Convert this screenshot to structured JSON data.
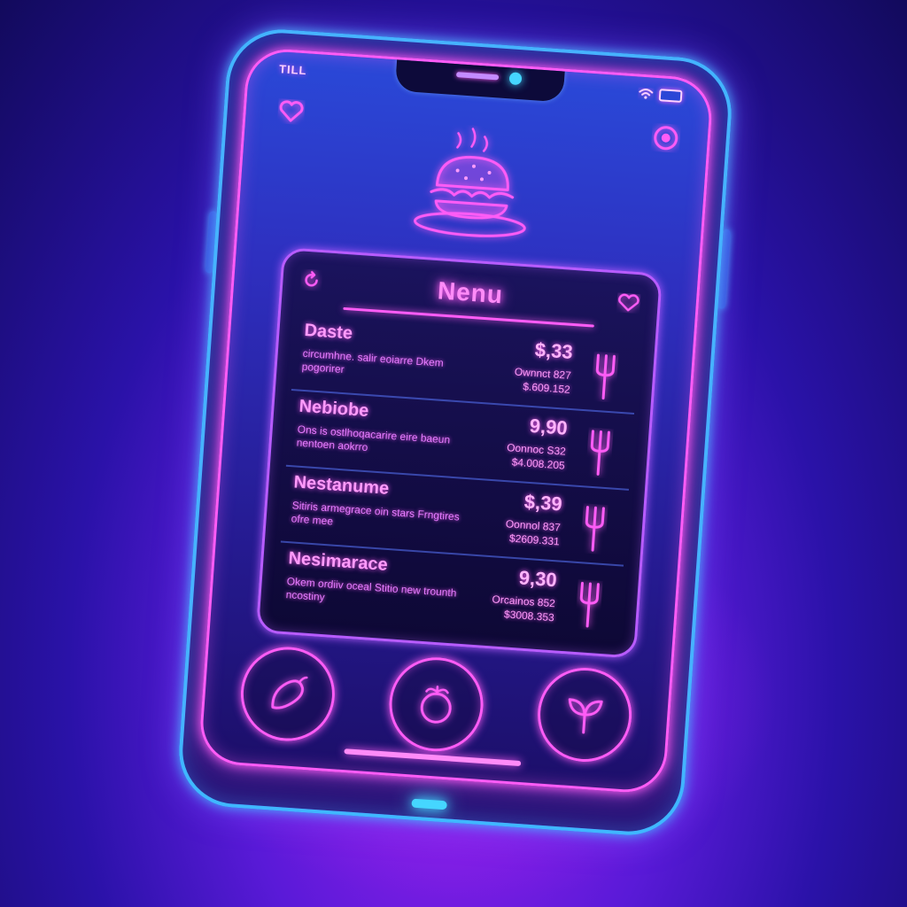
{
  "status_bar": {
    "left_text": "TILL"
  },
  "menu": {
    "title": "Nenu",
    "items": [
      {
        "name": "Daste",
        "desc": "circumhne. salir eoiarre Dkem pogorirer",
        "price": "$,33",
        "sub1": "Ownnct 827",
        "sub2": "$.609.152"
      },
      {
        "name": "Nebiobe",
        "desc": "Ons is ostlhoqacarire eire baeun nentoen aokrro",
        "price": "9,90",
        "sub1": "Oonnoc S32",
        "sub2": "$4.008.205"
      },
      {
        "name": "Nestanume",
        "desc": "Sitiris armegrace oin stars Frngtires ofre mee",
        "price": "$,39",
        "sub1": "Oonnol 837",
        "sub2": "$2609.331"
      },
      {
        "name": "Nesimarace",
        "desc": "Okem ordiiv oceal Stitio new trounth ncostiny",
        "price": "9,30",
        "sub1": "Orcainos 852",
        "sub2": "$3008.353"
      }
    ]
  },
  "icons": {
    "top_left": "heart-icon",
    "top_right": "camera-lens-icon",
    "hero": "burger-icon",
    "menu_left": "refresh-icon",
    "menu_right": "heart-icon",
    "row_action": "fork-icon",
    "nav": [
      "chili-pepper-icon",
      "tomato-icon",
      "leaf-icon"
    ]
  },
  "colors": {
    "neon_pink": "#ff5cf6",
    "neon_blue": "#3fb7ff",
    "neon_purple": "#b85cff"
  }
}
